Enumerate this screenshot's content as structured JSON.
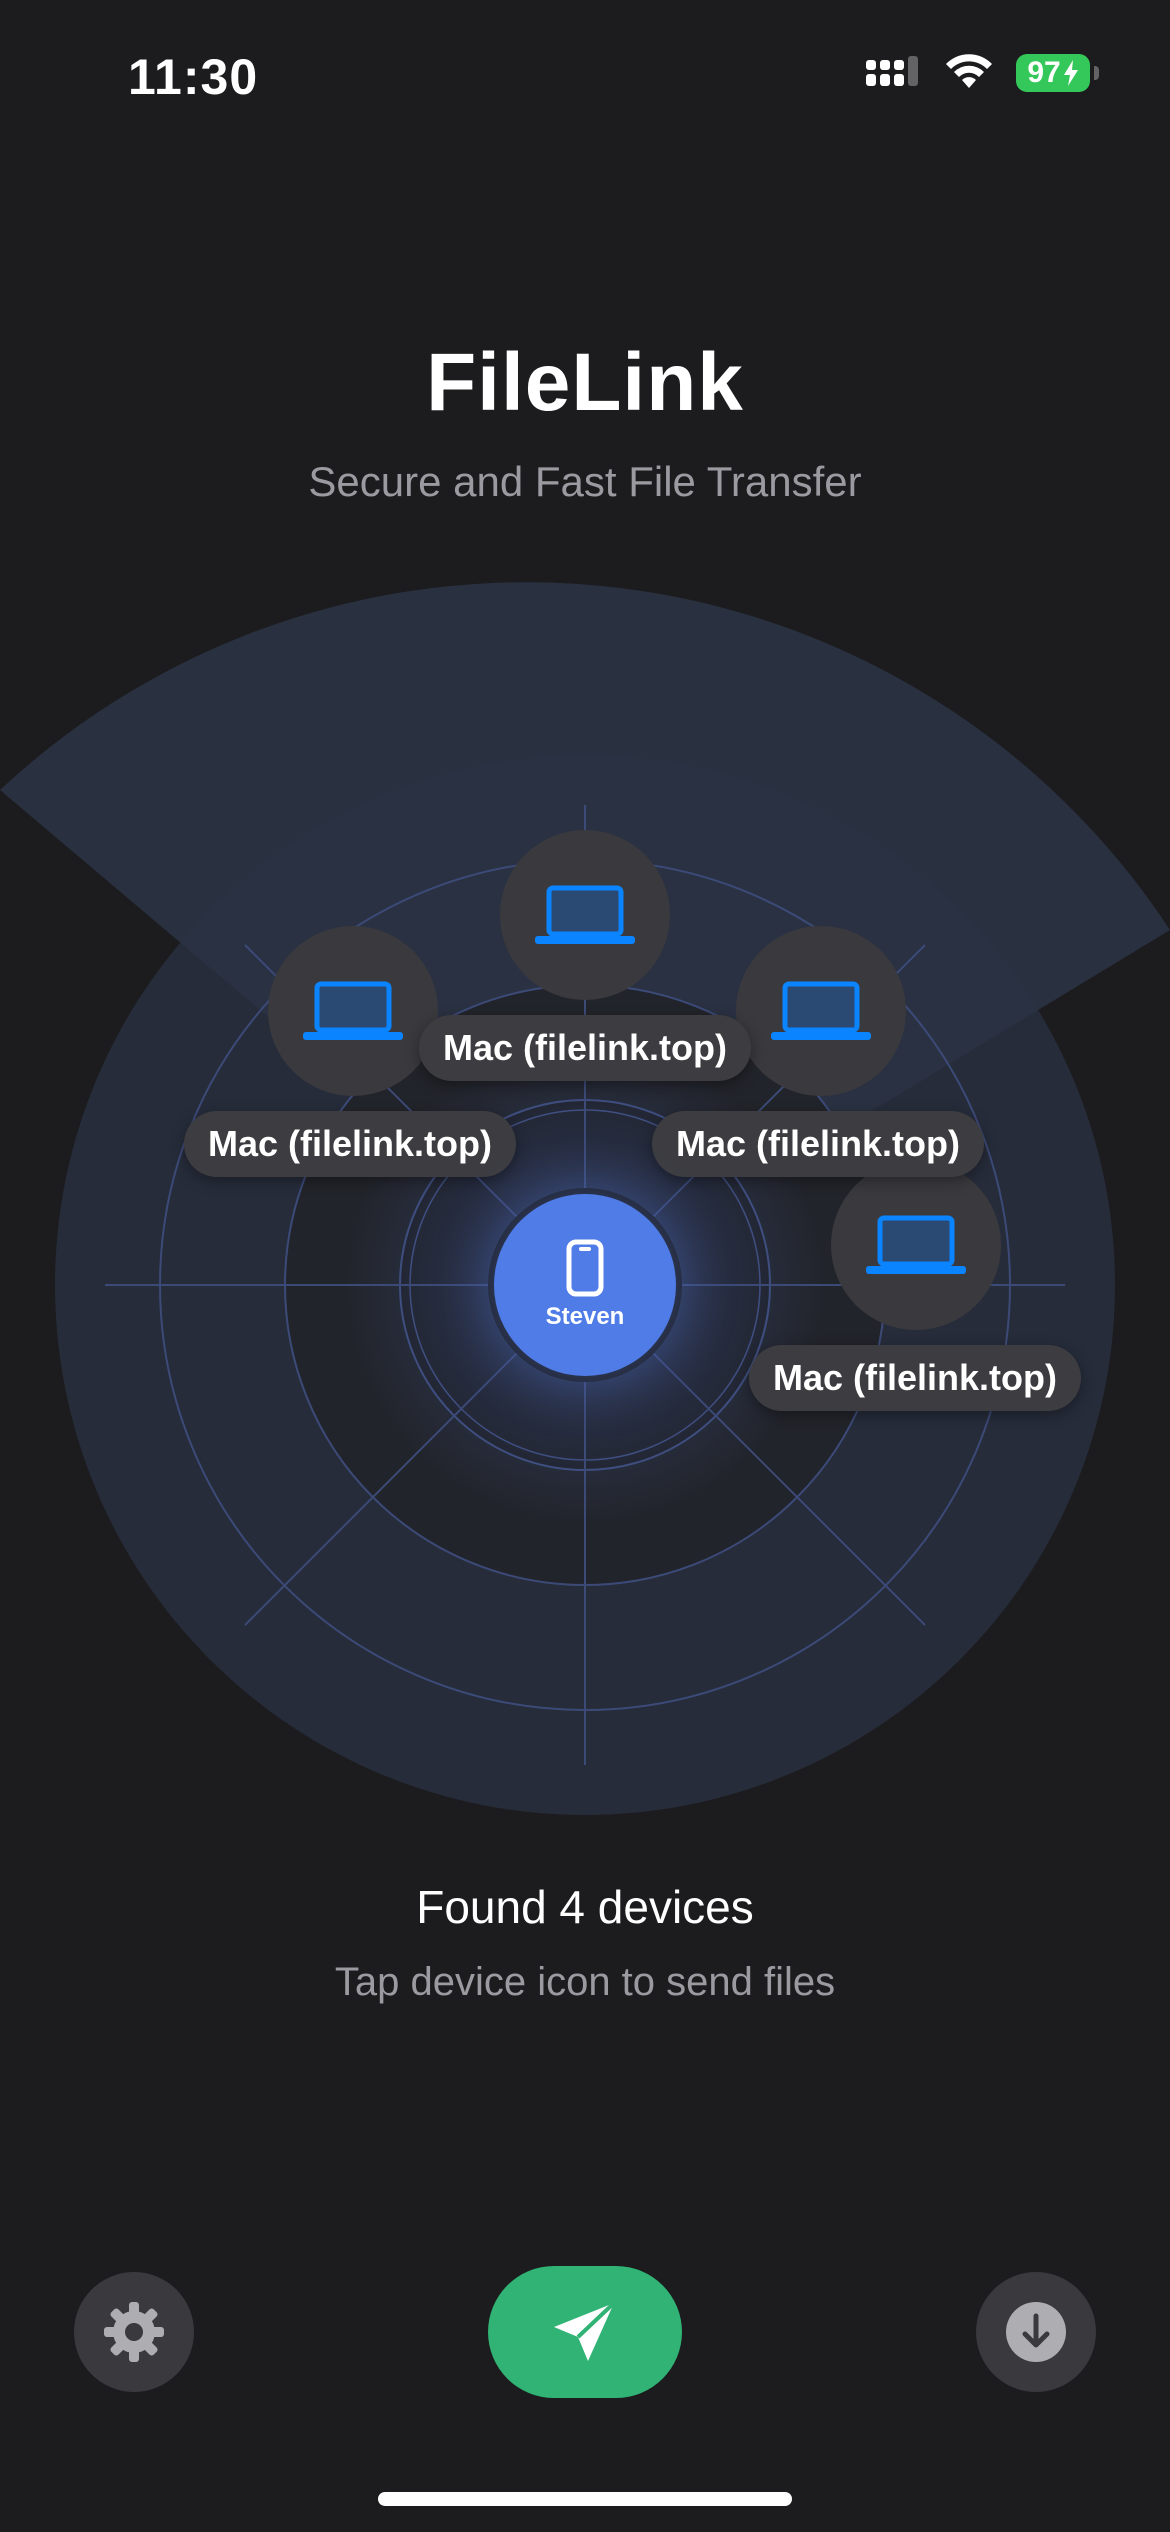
{
  "status_bar": {
    "time": "11:30",
    "battery": "97",
    "icons": [
      "cellular-signal-icon",
      "wifi-icon",
      "battery-charging-icon"
    ]
  },
  "header": {
    "title": "FileLink",
    "subtitle": "Secure and Fast File Transfer"
  },
  "radar": {
    "self_device": {
      "name": "Steven",
      "icon": "iphone-icon"
    },
    "devices": [
      {
        "label": "Mac (filelink.top)",
        "icon": "laptop-icon"
      },
      {
        "label": "Mac (filelink.top)",
        "icon": "laptop-icon"
      },
      {
        "label": "Mac (filelink.top)",
        "icon": "laptop-icon"
      },
      {
        "label": "Mac (filelink.top)",
        "icon": "laptop-icon"
      }
    ]
  },
  "status": {
    "found": "Found 4 devices",
    "hint": "Tap device icon to send files"
  },
  "toolbar": {
    "settings_icon": "gear-icon",
    "send_icon": "paper-plane-icon",
    "receive_icon": "download-arrow-icon"
  },
  "colors": {
    "background": "#1c1c1e",
    "accent_blue": "#0a84ff",
    "self_blue": "#4f7ce6",
    "send_green": "#30b374",
    "battery_green": "#34c759",
    "node_gray": "#3a3a3e"
  }
}
